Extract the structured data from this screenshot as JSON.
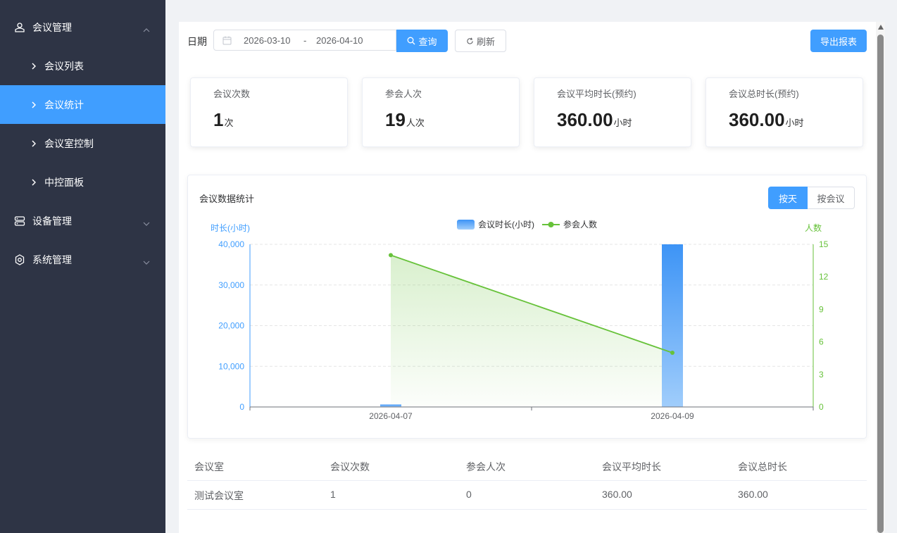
{
  "sidebar": {
    "groups": [
      {
        "label": "会议管理",
        "icon": "meeting-icon",
        "expanded": true
      },
      {
        "label": "设备管理",
        "icon": "device-icon",
        "expanded": false
      },
      {
        "label": "系统管理",
        "icon": "gear-icon",
        "expanded": false
      }
    ],
    "sub_items": [
      {
        "label": "会议列表",
        "active": false
      },
      {
        "label": "会议统计",
        "active": true
      },
      {
        "label": "会议室控制",
        "active": false
      },
      {
        "label": "中控面板",
        "active": false
      }
    ],
    "colors": {
      "bg": "#2e3445",
      "active": "#409eff"
    }
  },
  "toolbar": {
    "date_label": "日期",
    "start_date": "2026-03-10",
    "separator": "-",
    "end_date": "2026-04-10",
    "query_label": "查询",
    "refresh_label": "刷新",
    "export_label": "导出报表"
  },
  "stats": [
    {
      "label": "会议次数",
      "value": "1",
      "unit": "次"
    },
    {
      "label": "参会人次",
      "value": "19",
      "unit": "人次"
    },
    {
      "label": "会议平均时长(预约)",
      "value": "360.00",
      "unit": "小时"
    },
    {
      "label": "会议总时长(预约)",
      "value": "360.00",
      "unit": "小时"
    }
  ],
  "chart_panel": {
    "title": "会议数据统计",
    "toggle_day": "按天",
    "toggle_meeting": "按会议",
    "selected": "按天"
  },
  "chart_data": {
    "type": "bar",
    "categories": [
      "2026-04-07",
      "2026-04-09"
    ],
    "series": [
      {
        "name": "会议时长(小时)",
        "type": "bar",
        "axis": "left",
        "values": [
          600,
          40000
        ],
        "color": "#409eff"
      },
      {
        "name": "参会人数",
        "type": "line",
        "axis": "right",
        "values": [
          14,
          5
        ],
        "color": "#67c23a",
        "area": true
      }
    ],
    "ylabel": "时长(小时)",
    "ylabel_right": "人数",
    "ylim": [
      0,
      40000
    ],
    "ylim_right": [
      0,
      15
    ],
    "yticks": [
      "0",
      "10,000",
      "20,000",
      "30,000",
      "40,000"
    ],
    "yticks_right": [
      "0",
      "3",
      "6",
      "9",
      "12",
      "15"
    ],
    "legend": "top-center",
    "grid": true
  },
  "table": {
    "headers": [
      "会议室",
      "会议次数",
      "参会人次",
      "会议平均时长",
      "会议总时长"
    ],
    "rows": [
      [
        "测试会议室",
        "1",
        "0",
        "360.00",
        "360.00"
      ]
    ]
  }
}
